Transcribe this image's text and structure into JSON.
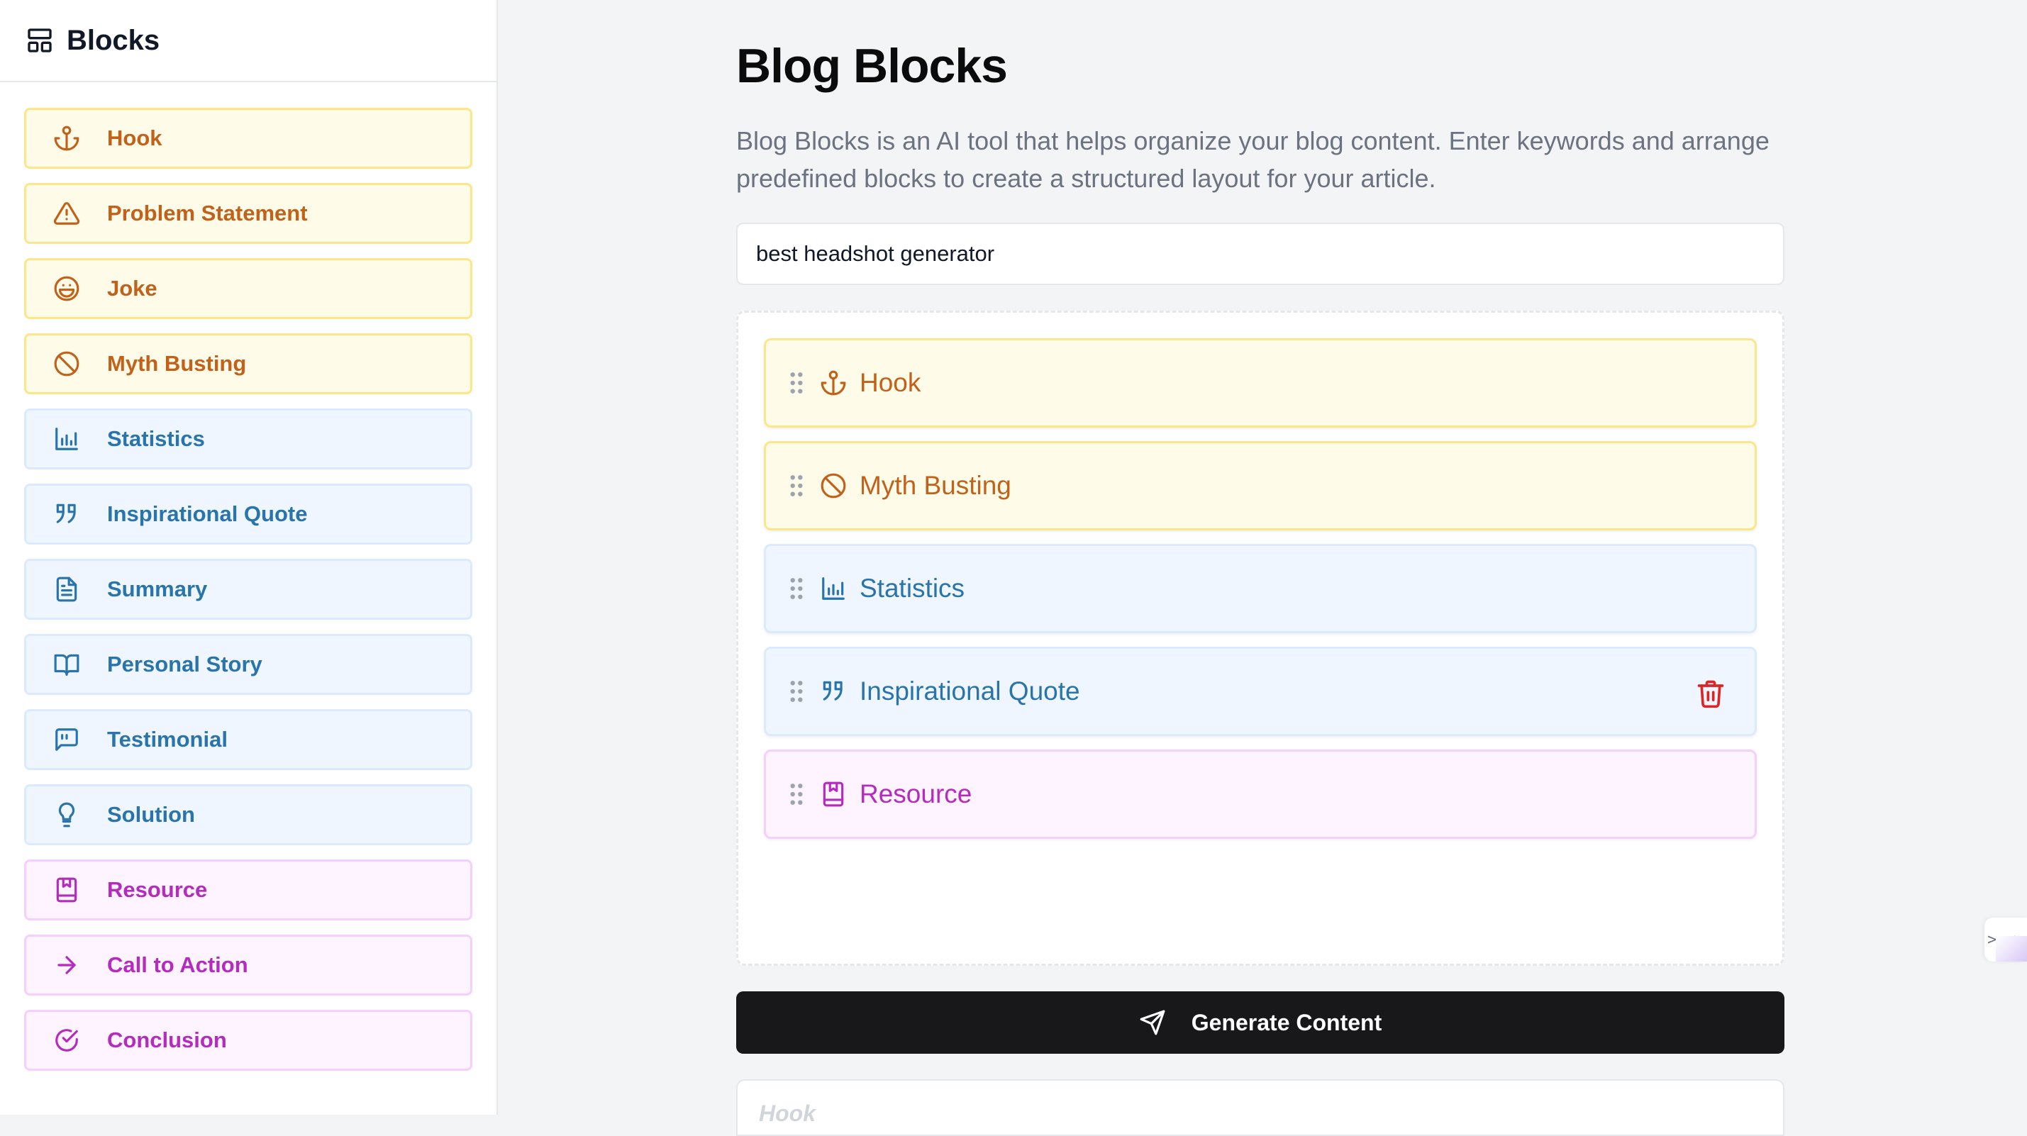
{
  "sidebar": {
    "title": "Blocks",
    "icon": "layout-icon",
    "items": [
      {
        "label": "Hook",
        "icon": "anchor-icon",
        "color": "yellow"
      },
      {
        "label": "Problem Statement",
        "icon": "warning-icon",
        "color": "yellow"
      },
      {
        "label": "Joke",
        "icon": "laugh-icon",
        "color": "yellow"
      },
      {
        "label": "Myth Busting",
        "icon": "ban-icon",
        "color": "yellow"
      },
      {
        "label": "Statistics",
        "icon": "bar-chart-icon",
        "color": "blue"
      },
      {
        "label": "Inspirational Quote",
        "icon": "quote-icon",
        "color": "blue"
      },
      {
        "label": "Summary",
        "icon": "file-text-icon",
        "color": "blue"
      },
      {
        "label": "Personal Story",
        "icon": "book-open-icon",
        "color": "blue"
      },
      {
        "label": "Testimonial",
        "icon": "message-quote-icon",
        "color": "blue"
      },
      {
        "label": "Solution",
        "icon": "lightbulb-icon",
        "color": "blue"
      },
      {
        "label": "Resource",
        "icon": "bookmark-book-icon",
        "color": "pink"
      },
      {
        "label": "Call to Action",
        "icon": "arrow-right-icon",
        "color": "pink"
      },
      {
        "label": "Conclusion",
        "icon": "check-circle-icon",
        "color": "pink"
      }
    ]
  },
  "main": {
    "title": "Blog Blocks",
    "description": "Blog Blocks is an AI tool that helps organize your blog content. Enter keywords and arrange predefined blocks to create a structured layout for your article.",
    "keyword_value": "best headshot generator",
    "canvas_blocks": [
      {
        "label": "Hook",
        "icon": "anchor-icon",
        "color": "yellow"
      },
      {
        "label": "Myth Busting",
        "icon": "ban-icon",
        "color": "yellow"
      },
      {
        "label": "Statistics",
        "icon": "bar-chart-icon",
        "color": "blue"
      },
      {
        "label": "Inspirational Quote",
        "icon": "quote-icon",
        "color": "blue",
        "hovered": true
      },
      {
        "label": "Resource",
        "icon": "bookmark-book-icon",
        "color": "pink"
      }
    ],
    "generate_label": "Generate Content",
    "generate_icon": "send-icon",
    "output_preview_heading": "Hook"
  },
  "side_handle": {
    "glyph": ">_<"
  },
  "colors": {
    "yellow_bg": "#fefce8",
    "yellow_border": "#fde68a",
    "yellow_text": "#c2611a",
    "blue_bg": "#eff6ff",
    "blue_border": "#dbeafe",
    "blue_text": "#2874ab",
    "pink_bg": "#fdf4ff",
    "pink_border": "#f5d0fe",
    "pink_text": "#b42bbd",
    "delete_red": "#dc2626",
    "button_dark": "#18181b"
  }
}
